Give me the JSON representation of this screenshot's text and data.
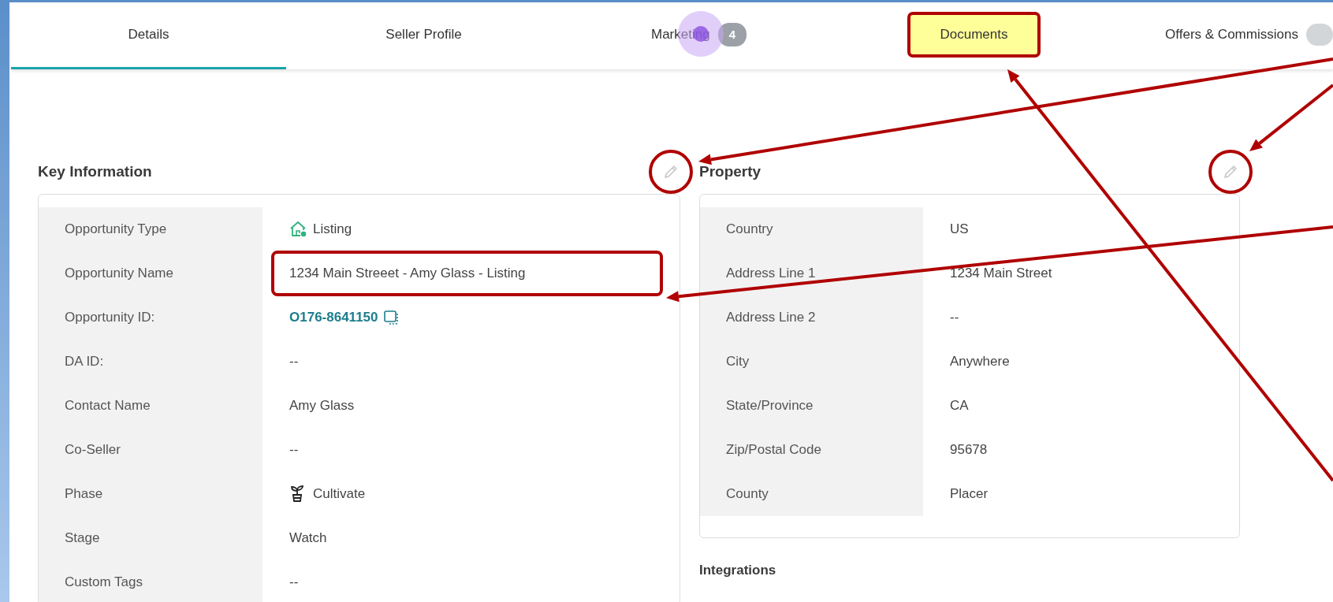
{
  "tabs": [
    {
      "label": "Details",
      "selected": true
    },
    {
      "label": "Seller Profile",
      "selected": false
    },
    {
      "label": "Marketing",
      "selected": false,
      "badge": "4",
      "clicked": true
    },
    {
      "label": "Documents",
      "selected": false,
      "highlighted": true
    },
    {
      "label": "Offers & Commissions",
      "selected": false,
      "partial_badge": true
    }
  ],
  "key_information": {
    "title": "Key Information",
    "edit_circled": true,
    "rows": [
      {
        "label": "Opportunity Type",
        "value": "Listing",
        "kind": "house"
      },
      {
        "label": "Opportunity Name",
        "value": "1234 Main Streeet - Amy Glass - Listing",
        "outlined": true
      },
      {
        "label": "Opportunity ID:",
        "value": "O176-8641150",
        "kind": "link"
      },
      {
        "label": "DA ID:",
        "value": "--"
      },
      {
        "label": "Contact Name",
        "value": "Amy Glass"
      },
      {
        "label": "Co-Seller",
        "value": "--"
      },
      {
        "label": "Phase",
        "value": "Cultivate",
        "kind": "plant"
      },
      {
        "label": "Stage",
        "value": "Watch"
      },
      {
        "label": "Custom Tags",
        "value": "--"
      }
    ]
  },
  "property": {
    "title": "Property",
    "edit_circled": true,
    "rows": [
      {
        "label": "Country",
        "value": "US"
      },
      {
        "label": "Address Line 1",
        "value": "1234 Main Street"
      },
      {
        "label": "Address Line 2",
        "value": "--"
      },
      {
        "label": "City",
        "value": "Anywhere"
      },
      {
        "label": "State/Province",
        "value": "CA"
      },
      {
        "label": "Zip/Postal Code",
        "value": "95678"
      },
      {
        "label": "County",
        "value": "Placer"
      }
    ]
  },
  "integrations": {
    "title": "Integrations"
  }
}
